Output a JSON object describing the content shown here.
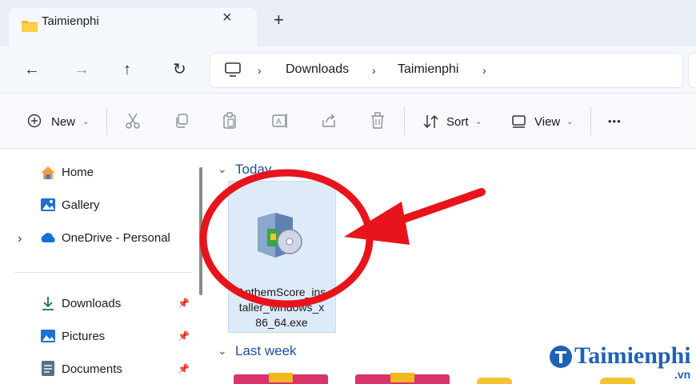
{
  "tab": {
    "title": "Taimienphi",
    "close": "×",
    "new": "+"
  },
  "nav": {
    "back": "←",
    "forward": "→",
    "up": "↑",
    "refresh": "↻"
  },
  "breadcrumb": {
    "items": [
      "Downloads",
      "Taimienphi"
    ]
  },
  "commandbar": {
    "new_label": "New",
    "sort_label": "Sort",
    "view_label": "View",
    "more": "•••"
  },
  "sidebar": {
    "items": [
      {
        "label": "Home"
      },
      {
        "label": "Gallery"
      },
      {
        "label": "OneDrive - Personal"
      },
      {
        "label": "Downloads"
      },
      {
        "label": "Pictures"
      },
      {
        "label": "Documents"
      }
    ]
  },
  "content": {
    "groups": [
      {
        "label": "Today"
      },
      {
        "label": "Last week"
      }
    ],
    "file": {
      "name_line1": "AnthemScore_ins",
      "name_line2": "taller_windows_x",
      "name_line3": "86_64.exe"
    }
  },
  "watermark": {
    "text": "Taimienphi",
    "suffix": ".vn"
  },
  "colors": {
    "accent": "#1e62b5",
    "annotation": "#e8141b",
    "selection": "#ddeaf8"
  }
}
